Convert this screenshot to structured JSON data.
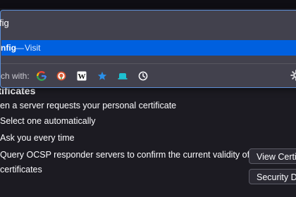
{
  "settings": {
    "section_heading": "rtificates",
    "request_desc": "en a server requests your personal certificate",
    "option_select_auto": "Select one automatically",
    "option_ask": "Ask you every time",
    "ocsp_line1": "Query OCSP responder servers to confirm the current validity of",
    "ocsp_line2": "certificates",
    "view_certificates_button": "View Certifi",
    "security_devices_button": "Security Dev"
  },
  "url_bar": {
    "input_value": "fig"
  },
  "suggestion": {
    "main": "nfig",
    "separator": "—",
    "action": "Visit"
  },
  "search_shortcuts": {
    "label": "ch with:",
    "engines": [
      {
        "name": "Google",
        "icon": "google-icon"
      },
      {
        "name": "DuckDuckGo",
        "icon": "duckduckgo-icon"
      },
      {
        "name": "Wikipedia",
        "icon": "wikipedia-icon"
      },
      {
        "name": "Bookmarks",
        "icon": "star-icon"
      },
      {
        "name": "Tabs",
        "icon": "tab-icon"
      },
      {
        "name": "History",
        "icon": "clock-icon"
      }
    ],
    "settings_icon": "gear-icon"
  },
  "colors": {
    "page_bg": "#1c1b22",
    "dropdown_bg": "#42414d",
    "accent": "#0060df",
    "focus_border": "#5d8fd6",
    "star_blue": "#2a8fe8",
    "tab_teal": "#1ec0d0"
  }
}
